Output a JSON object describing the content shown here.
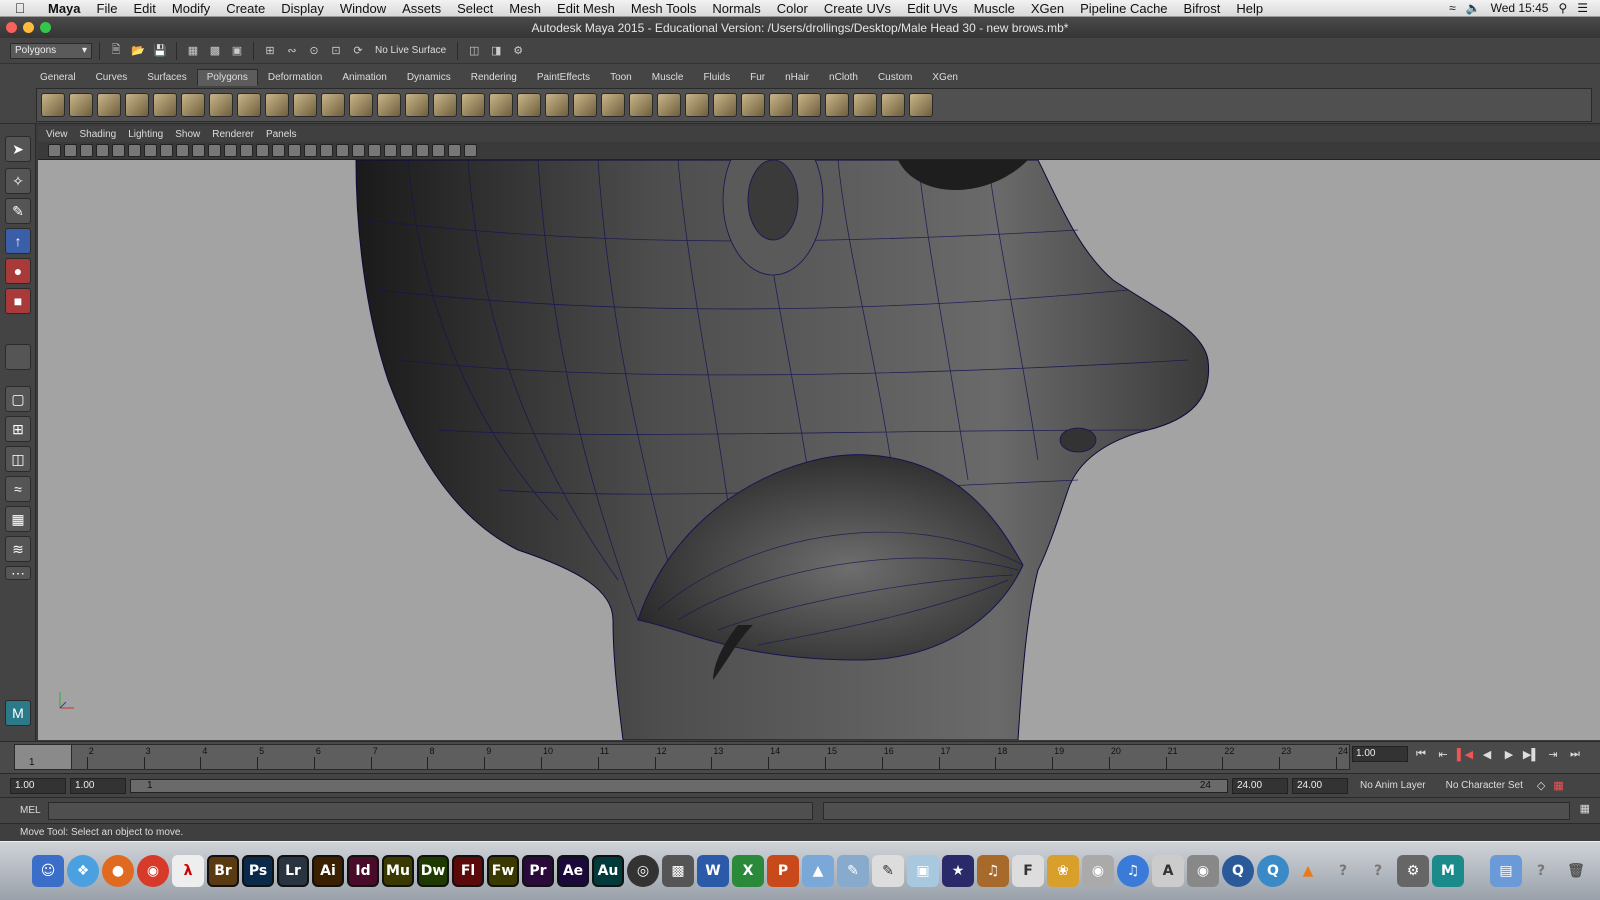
{
  "menubar": {
    "app_name": "Maya",
    "items": [
      "File",
      "Edit",
      "Modify",
      "Create",
      "Display",
      "Window",
      "Assets",
      "Select",
      "Mesh",
      "Edit Mesh",
      "Mesh Tools",
      "Normals",
      "Color",
      "Create UVs",
      "Edit UVs",
      "Muscle",
      "XGen",
      "Pipeline Cache",
      "Bifrost",
      "Help"
    ],
    "clock": "Wed 15:45"
  },
  "window": {
    "title": "Autodesk Maya 2015 - Educational Version: /Users/drollings/Desktop/Male Head 30 - new brows.mb*"
  },
  "statusline": {
    "menuset": "Polygons",
    "live_surface": "No Live Surface"
  },
  "shelf": {
    "tabs": [
      "General",
      "Curves",
      "Surfaces",
      "Polygons",
      "Deformation",
      "Animation",
      "Dynamics",
      "Rendering",
      "PaintEffects",
      "Toon",
      "Muscle",
      "Fluids",
      "Fur",
      "nHair",
      "nCloth",
      "Custom",
      "XGen"
    ],
    "active_tab": "Polygons"
  },
  "panel": {
    "menus": [
      "View",
      "Shading",
      "Lighting",
      "Show",
      "Renderer",
      "Panels"
    ]
  },
  "timeslider": {
    "ticks": [
      "1",
      "2",
      "3",
      "4",
      "5",
      "6",
      "7",
      "8",
      "9",
      "10",
      "11",
      "12",
      "13",
      "14",
      "15",
      "16",
      "17",
      "18",
      "19",
      "20",
      "21",
      "22",
      "23",
      "24"
    ],
    "current_frame": "1",
    "current_time_field": "1.00"
  },
  "rangeslider": {
    "start_time": "1.00",
    "playback_start": "1.00",
    "range_start_label": "1",
    "range_end_label": "24",
    "playback_end": "24.00",
    "end_time": "24.00",
    "anim_layer": "No Anim Layer",
    "character_set": "No Character Set"
  },
  "cmdline": {
    "label": "MEL"
  },
  "helpline": {
    "text": "Move Tool: Select an object to move."
  },
  "dock": {
    "apps": [
      {
        "label": "Br",
        "color": "#5a3a10"
      },
      {
        "label": "Ps",
        "color": "#0b2a4a"
      },
      {
        "label": "Lr",
        "color": "#2a3440"
      },
      {
        "label": "Ai",
        "color": "#3a1f00"
      },
      {
        "label": "Id",
        "color": "#4a0a2a"
      },
      {
        "label": "Mu",
        "color": "#3a3a00"
      },
      {
        "label": "Dw",
        "color": "#1f3a00"
      },
      {
        "label": "Fl",
        "color": "#5a0a0a"
      },
      {
        "label": "Fw",
        "color": "#3a3a00"
      },
      {
        "label": "Pr",
        "color": "#2a0a3a"
      },
      {
        "label": "Ae",
        "color": "#1a0a3a"
      },
      {
        "label": "Au",
        "color": "#003a3a"
      }
    ]
  }
}
